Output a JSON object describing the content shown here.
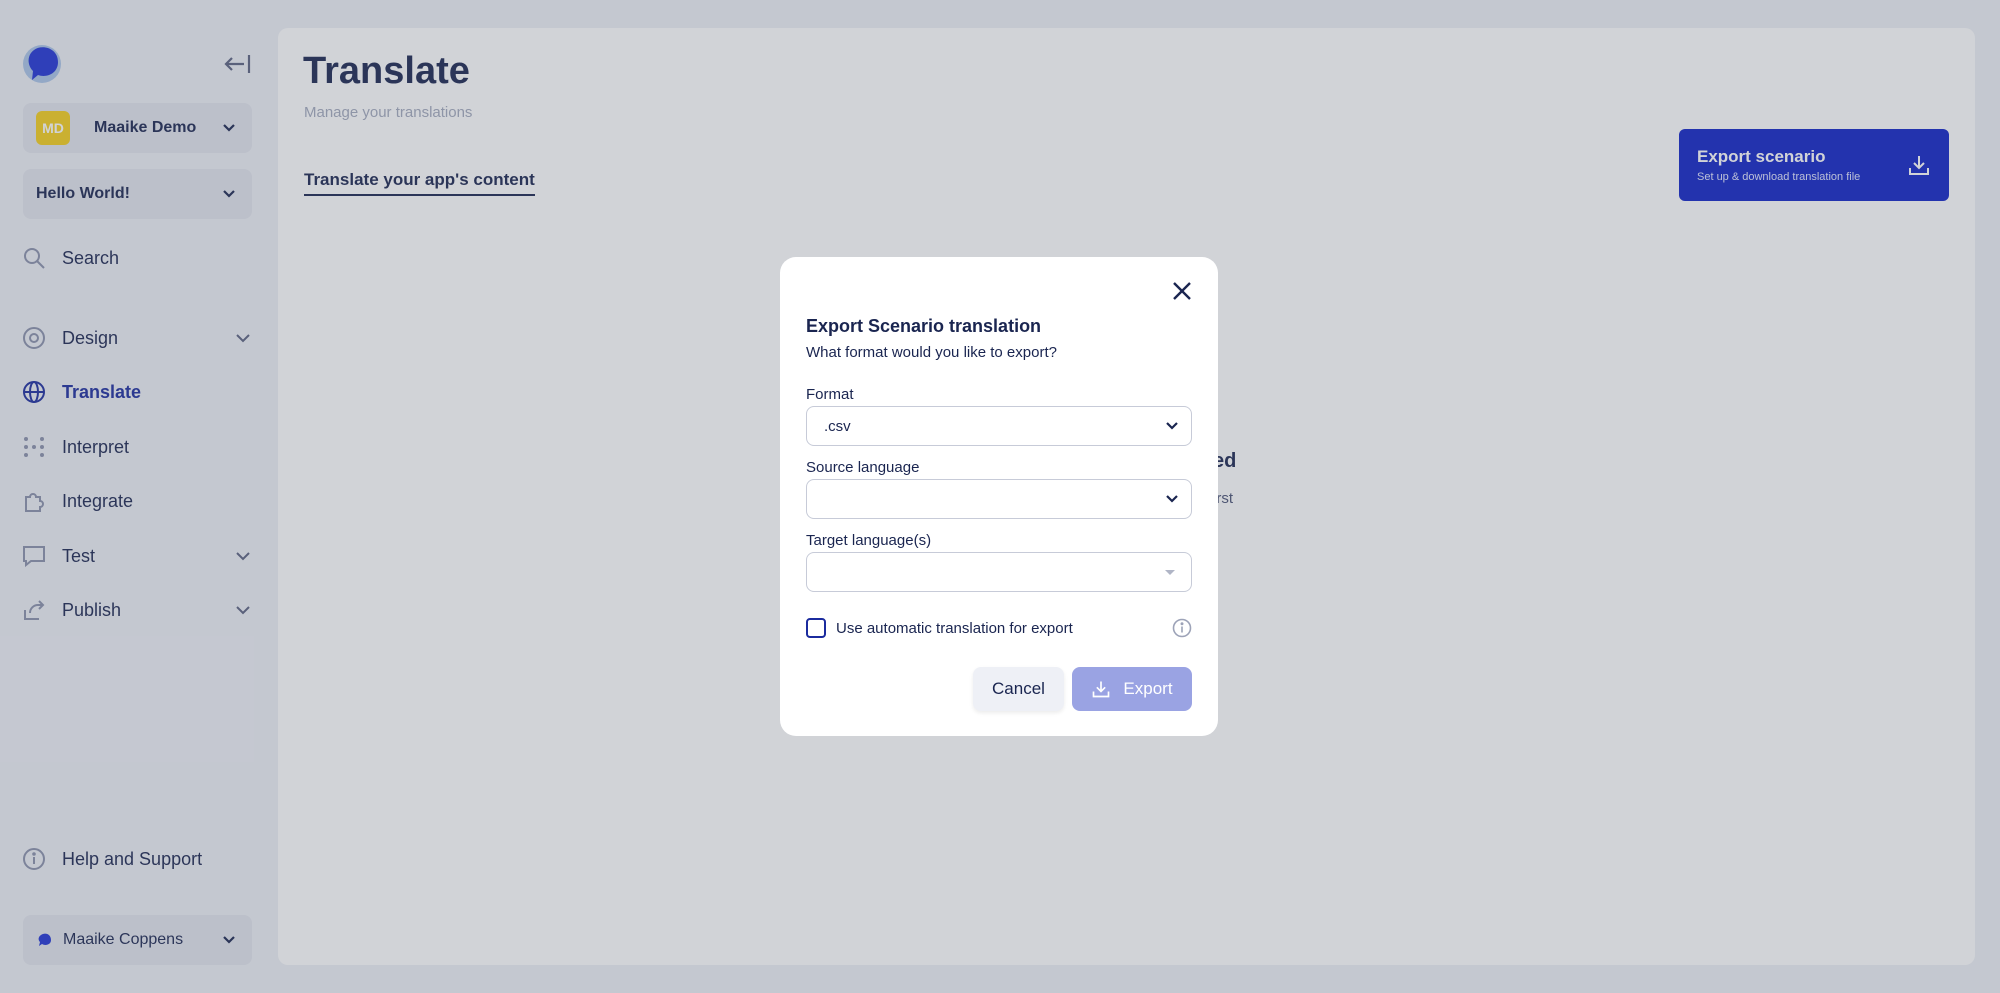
{
  "sidebar": {
    "workspace": {
      "initials": "MD",
      "name": "Maaike Demo",
      "avatar_color": "#f5cf19"
    },
    "app": {
      "name": "Hello World!"
    },
    "nav": [
      {
        "label": "Search",
        "icon": "search-icon"
      },
      {
        "label": "Design",
        "icon": "palette-icon",
        "expandable": true
      },
      {
        "label": "Translate",
        "icon": "globe-icon",
        "active": true
      },
      {
        "label": "Interpret",
        "icon": "dots-grid-icon"
      },
      {
        "label": "Integrate",
        "icon": "puzzle-icon"
      },
      {
        "label": "Test",
        "icon": "chat-bubble-icon",
        "expandable": true
      },
      {
        "label": "Publish",
        "icon": "share-icon",
        "expandable": true
      }
    ],
    "help": {
      "label": "Help and Support",
      "icon": "info-icon"
    },
    "user": {
      "name": "Maaike Coppens"
    }
  },
  "main": {
    "title": "Translate",
    "subtitle": "Manage your translations",
    "tab": "Translate your app's content",
    "export_button": {
      "title": "Export scenario",
      "subtitle": "Set up & download translation file"
    },
    "empty_state": {
      "title_fragment": "ed",
      "text_fragment": "irst"
    }
  },
  "modal": {
    "title": "Export Scenario translation",
    "question": "What format would you like to export?",
    "format": {
      "label": "Format",
      "value": ".csv"
    },
    "source_language": {
      "label": "Source language",
      "value": ""
    },
    "target_languages": {
      "label": "Target language(s)",
      "value": ""
    },
    "auto_translate": {
      "label": "Use automatic translation for export",
      "checked": false
    },
    "cancel_label": "Cancel",
    "export_label": "Export"
  },
  "colors": {
    "brand": "#0f22c7",
    "nav_active": "#1b2b9e",
    "text": "#1a2550",
    "export_disabled": "#9aa3e3"
  }
}
